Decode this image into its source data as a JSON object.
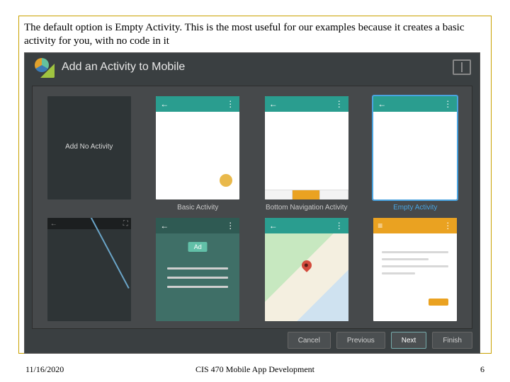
{
  "slide": {
    "caption": "The default option is Empty Activity. This is the most useful for our examples because it creates a basic activity for you, with no code in it"
  },
  "wizard": {
    "title": "Add an Activity to Mobile",
    "templates": [
      {
        "id": "none",
        "label": "Add No Activity",
        "selected": false
      },
      {
        "id": "basic",
        "label": "Basic Activity",
        "selected": false
      },
      {
        "id": "btmnav",
        "label": "Bottom Navigation Activity",
        "selected": false
      },
      {
        "id": "empty",
        "label": "Empty Activity",
        "selected": true
      },
      {
        "id": "fullscr",
        "label": "",
        "selected": false
      },
      {
        "id": "admob",
        "label": "",
        "selected": false
      },
      {
        "id": "maps",
        "label": "",
        "selected": false
      },
      {
        "id": "md",
        "label": "",
        "selected": false
      }
    ],
    "ad_badge": "Ad",
    "back_arrow": "←",
    "menu_dots": "⋮",
    "hamburger": "≡",
    "expand": "⛶",
    "buttons": {
      "cancel": "Cancel",
      "previous": "Previous",
      "next": "Next",
      "finish": "Finish"
    }
  },
  "footer": {
    "date": "11/16/2020",
    "course": "CIS 470 Mobile App Development",
    "page": "6"
  }
}
